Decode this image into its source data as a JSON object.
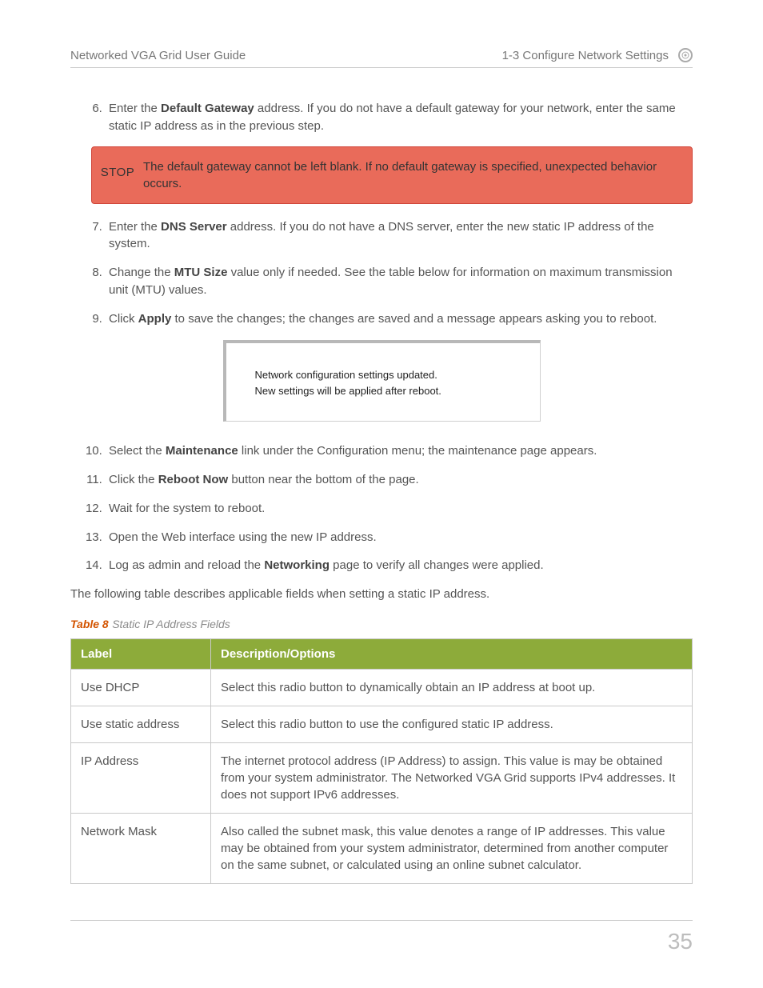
{
  "header": {
    "left": "Networked VGA Grid User Guide",
    "right": "1-3 Configure Network Settings"
  },
  "steps": [
    {
      "n": 6,
      "segments": [
        {
          "t": "Enter the "
        },
        {
          "t": "Default Gateway",
          "b": true
        },
        {
          "t": " address. If you do not have a default gateway for your network, enter the same static IP address as in the previous step."
        }
      ]
    },
    {
      "n": 7,
      "segments": [
        {
          "t": "Enter the "
        },
        {
          "t": "DNS Server",
          "b": true
        },
        {
          "t": " address. If you do not have a DNS server, enter the new static IP address of the system."
        }
      ]
    },
    {
      "n": 8,
      "segments": [
        {
          "t": "Change the "
        },
        {
          "t": "MTU Size",
          "b": true
        },
        {
          "t": " value only if needed. See the table below for information on maximum transmission unit (MTU) values."
        }
      ]
    },
    {
      "n": 9,
      "segments": [
        {
          "t": "Click "
        },
        {
          "t": "Apply",
          "b": true
        },
        {
          "t": " to save the changes; the changes are saved and a message appears asking you to reboot."
        }
      ]
    },
    {
      "n": 10,
      "segments": [
        {
          "t": "Select the "
        },
        {
          "t": "Maintenance",
          "b": true
        },
        {
          "t": " link under the Configuration menu; the maintenance page appears."
        }
      ]
    },
    {
      "n": 11,
      "segments": [
        {
          "t": "Click the "
        },
        {
          "t": "Reboot Now",
          "b": true
        },
        {
          "t": " button near the bottom of the page."
        }
      ]
    },
    {
      "n": 12,
      "segments": [
        {
          "t": "Wait for the system to reboot."
        }
      ]
    },
    {
      "n": 13,
      "segments": [
        {
          "t": "Open the Web interface using the new IP address."
        }
      ]
    },
    {
      "n": 14,
      "segments": [
        {
          "t": "Log as admin and reload the "
        },
        {
          "t": "Networking",
          "b": true
        },
        {
          "t": " page to verify all changes were applied."
        }
      ]
    }
  ],
  "callout": {
    "badge": "STOP",
    "text": "The default gateway cannot be left blank. If no default gateway is specified, unexpected behavior occurs."
  },
  "msgbox": {
    "line1": "Network configuration settings updated.",
    "line2": "New settings will be applied after reboot."
  },
  "intro_after_steps": "The following table describes applicable fields when setting a static IP address.",
  "table": {
    "caption_num": "Table 8",
    "caption_title": "Static IP Address Fields",
    "headers": {
      "label": "Label",
      "desc": "Description/Options"
    },
    "rows": [
      {
        "label": "Use DHCP",
        "desc": "Select this radio button to dynamically obtain an IP address at boot up."
      },
      {
        "label": "Use static address",
        "desc": "Select this radio button to use the configured static IP address."
      },
      {
        "label": "IP Address",
        "desc": "The internet protocol address (IP Address) to assign. This value is may be obtained from your system administrator. The Networked VGA Grid supports IPv4 addresses. It does not support IPv6 addresses."
      },
      {
        "label": "Network Mask",
        "desc": "Also called the subnet mask, this value denotes a range of IP addresses. This value may be obtained from your system administrator, determined from another computer on the same subnet, or calculated using an online subnet calculator."
      }
    ]
  },
  "page_number": "35"
}
